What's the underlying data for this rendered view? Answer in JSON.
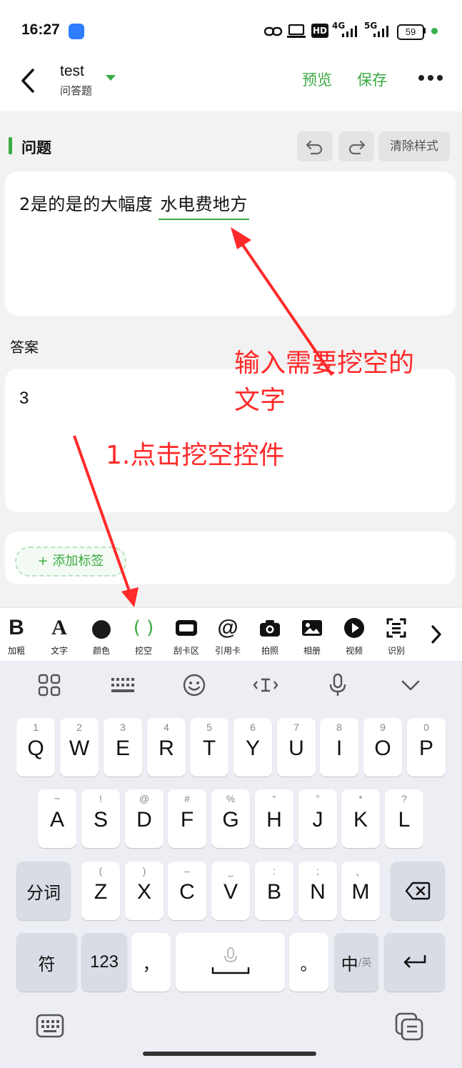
{
  "status_bar": {
    "time": "16:27",
    "network_labels": [
      "HD",
      "4G",
      "5G"
    ],
    "battery": "59",
    "battery_dot_color": "#38b24a"
  },
  "header": {
    "title": "test",
    "subtitle": "问答题",
    "preview_label": "预览",
    "save_label": "保存",
    "accent_color": "#3aab42"
  },
  "question": {
    "section_title": "问题",
    "clear_style_label": "清除样式",
    "text_before": "2是的是的大幅度 ",
    "blank_text": "水电费地方"
  },
  "answer": {
    "label": "答案",
    "text": "3"
  },
  "tags": {
    "add_label": "+ 添加标签"
  },
  "toolbar": {
    "items": [
      {
        "icon": "bold-icon",
        "glyph": "B",
        "label": "加粗"
      },
      {
        "icon": "text-icon",
        "glyph": "A",
        "label": "文字"
      },
      {
        "icon": "color-icon",
        "glyph": "●",
        "label": "颜色"
      },
      {
        "icon": "blank-icon",
        "glyph": "( )",
        "label": "挖空"
      },
      {
        "icon": "scratch-card-icon",
        "glyph": "▬",
        "label": "刮卡区"
      },
      {
        "icon": "at-icon",
        "glyph": "@",
        "label": "引用卡"
      },
      {
        "icon": "camera-icon",
        "glyph": "📷",
        "label": "拍照"
      },
      {
        "icon": "album-icon",
        "glyph": "🖼",
        "label": "相册"
      },
      {
        "icon": "video-icon",
        "glyph": "▶",
        "label": "视频"
      },
      {
        "icon": "scan-icon",
        "glyph": "⧈",
        "label": "识别"
      }
    ],
    "more_glyph": "›"
  },
  "keyboard": {
    "row1": [
      {
        "key": "Q",
        "hint": "1"
      },
      {
        "key": "W",
        "hint": "2"
      },
      {
        "key": "E",
        "hint": "3"
      },
      {
        "key": "R",
        "hint": "4"
      },
      {
        "key": "T",
        "hint": "5"
      },
      {
        "key": "Y",
        "hint": "6"
      },
      {
        "key": "U",
        "hint": "7"
      },
      {
        "key": "I",
        "hint": "8"
      },
      {
        "key": "O",
        "hint": "9"
      },
      {
        "key": "P",
        "hint": "0"
      }
    ],
    "row2": [
      {
        "key": "A",
        "hint": "~"
      },
      {
        "key": "S",
        "hint": "!"
      },
      {
        "key": "D",
        "hint": "@"
      },
      {
        "key": "F",
        "hint": "#"
      },
      {
        "key": "G",
        "hint": "%"
      },
      {
        "key": "H",
        "hint": "“"
      },
      {
        "key": "J",
        "hint": "”"
      },
      {
        "key": "K",
        "hint": "*"
      },
      {
        "key": "L",
        "hint": "?"
      }
    ],
    "row3": [
      {
        "key": "Z",
        "hint": "("
      },
      {
        "key": "X",
        "hint": ")"
      },
      {
        "key": "C",
        "hint": "–"
      },
      {
        "key": "V",
        "hint": "_"
      },
      {
        "key": "B",
        "hint": ":"
      },
      {
        "key": "N",
        "hint": ";"
      },
      {
        "key": "M",
        "hint": "、"
      }
    ],
    "segment_label": "分词",
    "symbol_label": "符",
    "num_label": "123",
    "comma": "，",
    "period": "。",
    "lang_main": "中",
    "lang_alt": "/英"
  },
  "annotations": {
    "arrow_color": "#ff2a2a",
    "input_hint_line1": "输入需要挖空的",
    "input_hint_line2": "文字",
    "click_hint": "1.点击挖空控件"
  }
}
